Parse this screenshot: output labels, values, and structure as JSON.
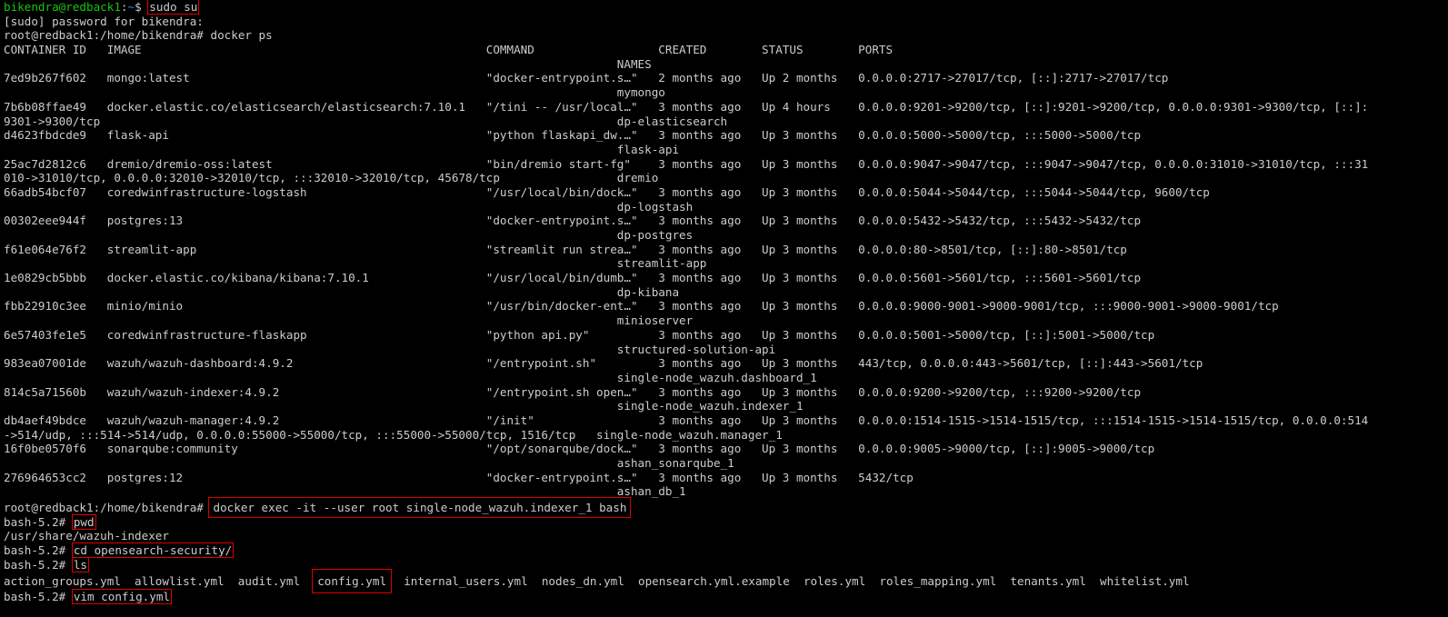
{
  "prompt_user": "bikendra@redback1",
  "prompt_path": "~",
  "prompt_symbol": "$",
  "cmd_sudo": "sudo su",
  "sudo_prompt": "[sudo] password for bikendra:",
  "root_prompt": "root@redback1:/home/bikendra#",
  "cmd_docker_ps": "docker ps",
  "ps_header": "CONTAINER ID   IMAGE                                                  COMMAND                  CREATED        STATUS        PORTS",
  "ps_header2": "                                                                                         NAMES",
  "ps_rows": [
    "7ed9b267f602   mongo:latest                                           \"docker-entrypoint.s…\"   2 months ago   Up 2 months   0.0.0.0:2717->27017/tcp, [::]:2717->27017/tcp",
    "                                                                                         mymongo",
    "7b6b08ffae49   docker.elastic.co/elasticsearch/elasticsearch:7.10.1   \"/tini -- /usr/local…\"   3 months ago   Up 4 hours    0.0.0.0:9201->9200/tcp, [::]:9201->9200/tcp, 0.0.0.0:9301->9300/tcp, [::]:",
    "9301->9300/tcp                                                                           dp-elasticsearch",
    "d4623fbdcde9   flask-api                                              \"python flaskapi_dw.…\"   3 months ago   Up 3 months   0.0.0.0:5000->5000/tcp, :::5000->5000/tcp",
    "                                                                                         flask-api",
    "25ac7d2812c6   dremio/dremio-oss:latest                               \"bin/dremio start-fg\"    3 months ago   Up 3 months   0.0.0.0:9047->9047/tcp, :::9047->9047/tcp, 0.0.0.0:31010->31010/tcp, :::31",
    "010->31010/tcp, 0.0.0.0:32010->32010/tcp, :::32010->32010/tcp, 45678/tcp                 dremio",
    "66adb54bcf07   coredwinfrastructure-logstash                          \"/usr/local/bin/dock…\"   3 months ago   Up 3 months   0.0.0.0:5044->5044/tcp, :::5044->5044/tcp, 9600/tcp",
    "                                                                                         dp-logstash",
    "00302eee944f   postgres:13                                            \"docker-entrypoint.s…\"   3 months ago   Up 3 months   0.0.0.0:5432->5432/tcp, :::5432->5432/tcp",
    "                                                                                         dp-postgres",
    "f61e064e76f2   streamlit-app                                          \"streamlit run strea…\"   3 months ago   Up 3 months   0.0.0.0:80->8501/tcp, [::]:80->8501/tcp",
    "                                                                                         streamlit-app",
    "1e0829cb5bbb   docker.elastic.co/kibana/kibana:7.10.1                 \"/usr/local/bin/dumb…\"   3 months ago   Up 3 months   0.0.0.0:5601->5601/tcp, :::5601->5601/tcp",
    "                                                                                         dp-kibana",
    "fbb22910c3ee   minio/minio                                            \"/usr/bin/docker-ent…\"   3 months ago   Up 3 months   0.0.0.0:9000-9001->9000-9001/tcp, :::9000-9001->9000-9001/tcp",
    "                                                                                         minioserver",
    "6e57403fe1e5   coredwinfrastructure-flaskapp                          \"python api.py\"          3 months ago   Up 3 months   0.0.0.0:5001->5000/tcp, [::]:5001->5000/tcp",
    "                                                                                         structured-solution-api",
    "983ea07001de   wazuh/wazuh-dashboard:4.9.2                            \"/entrypoint.sh\"         3 months ago   Up 3 months   443/tcp, 0.0.0.0:443->5601/tcp, [::]:443->5601/tcp",
    "                                                                                         single-node_wazuh.dashboard_1",
    "814c5a71560b   wazuh/wazuh-indexer:4.9.2                              \"/entrypoint.sh open…\"   3 months ago   Up 3 months   0.0.0.0:9200->9200/tcp, :::9200->9200/tcp",
    "                                                                                         single-node_wazuh.indexer_1",
    "db4aef49bdce   wazuh/wazuh-manager:4.9.2                              \"/init\"                  3 months ago   Up 3 months   0.0.0.0:1514-1515->1514-1515/tcp, :::1514-1515->1514-1515/tcp, 0.0.0.0:514",
    "->514/udp, :::514->514/udp, 0.0.0.0:55000->55000/tcp, :::55000->55000/tcp, 1516/tcp   single-node_wazuh.manager_1",
    "16f0be0570f6   sonarqube:community                                    \"/opt/sonarqube/dock…\"   3 months ago   Up 3 months   0.0.0.0:9005->9000/tcp, [::]:9005->9000/tcp",
    "                                                                                         ashan_sonarqube_1",
    "276964653cc2   postgres:12                                            \"docker-entrypoint.s…\"   3 months ago   Up 3 months   5432/tcp",
    "                                                                                         ashan_db_1"
  ],
  "cmd_exec": "docker exec -it --user root single-node_wazuh.indexer_1 bash",
  "bash_prompt": "bash-5.2#",
  "cmd_pwd": "pwd",
  "pwd_output": "/usr/share/wazuh-indexer",
  "cmd_cd": "cd opensearch-security/",
  "cmd_ls": "ls",
  "ls_before": "action_groups.yml  allowlist.yml  audit.yml  ",
  "ls_config": "config.yml",
  "ls_after": "  internal_users.yml  nodes_dn.yml  opensearch.yml.example  roles.yml  roles_mapping.yml  tenants.yml  whitelist.yml",
  "cmd_vim": "vim config.yml"
}
